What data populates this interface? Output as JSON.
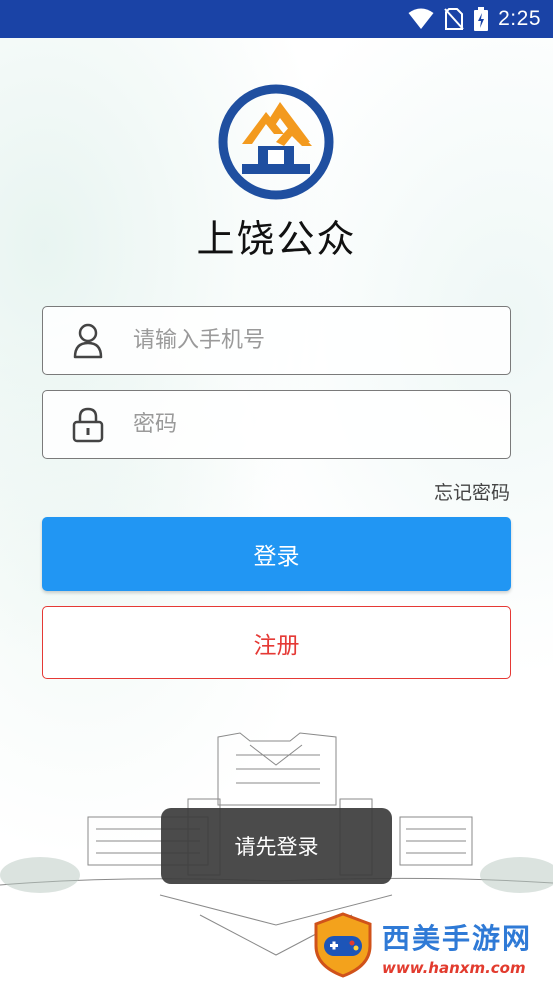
{
  "status_bar": {
    "time": "2:25",
    "bg_color": "#1a43a6"
  },
  "app": {
    "title": "上饶公众"
  },
  "form": {
    "phone_placeholder": "请输入手机号",
    "password_placeholder": "密码",
    "forgot_label": "忘记密码",
    "login_label": "登录",
    "register_label": "注册"
  },
  "toast": {
    "message": "请先登录"
  },
  "watermark": {
    "title": "西美手游网",
    "url": "www.hanxm.com"
  },
  "colors": {
    "primary": "#2196f3",
    "danger": "#e53935",
    "logo_blue": "#1f4fa0",
    "logo_orange": "#f39a1e"
  },
  "icons": [
    "wifi-icon",
    "no-sim-icon",
    "battery-charging-icon",
    "user-icon",
    "lock-icon"
  ]
}
